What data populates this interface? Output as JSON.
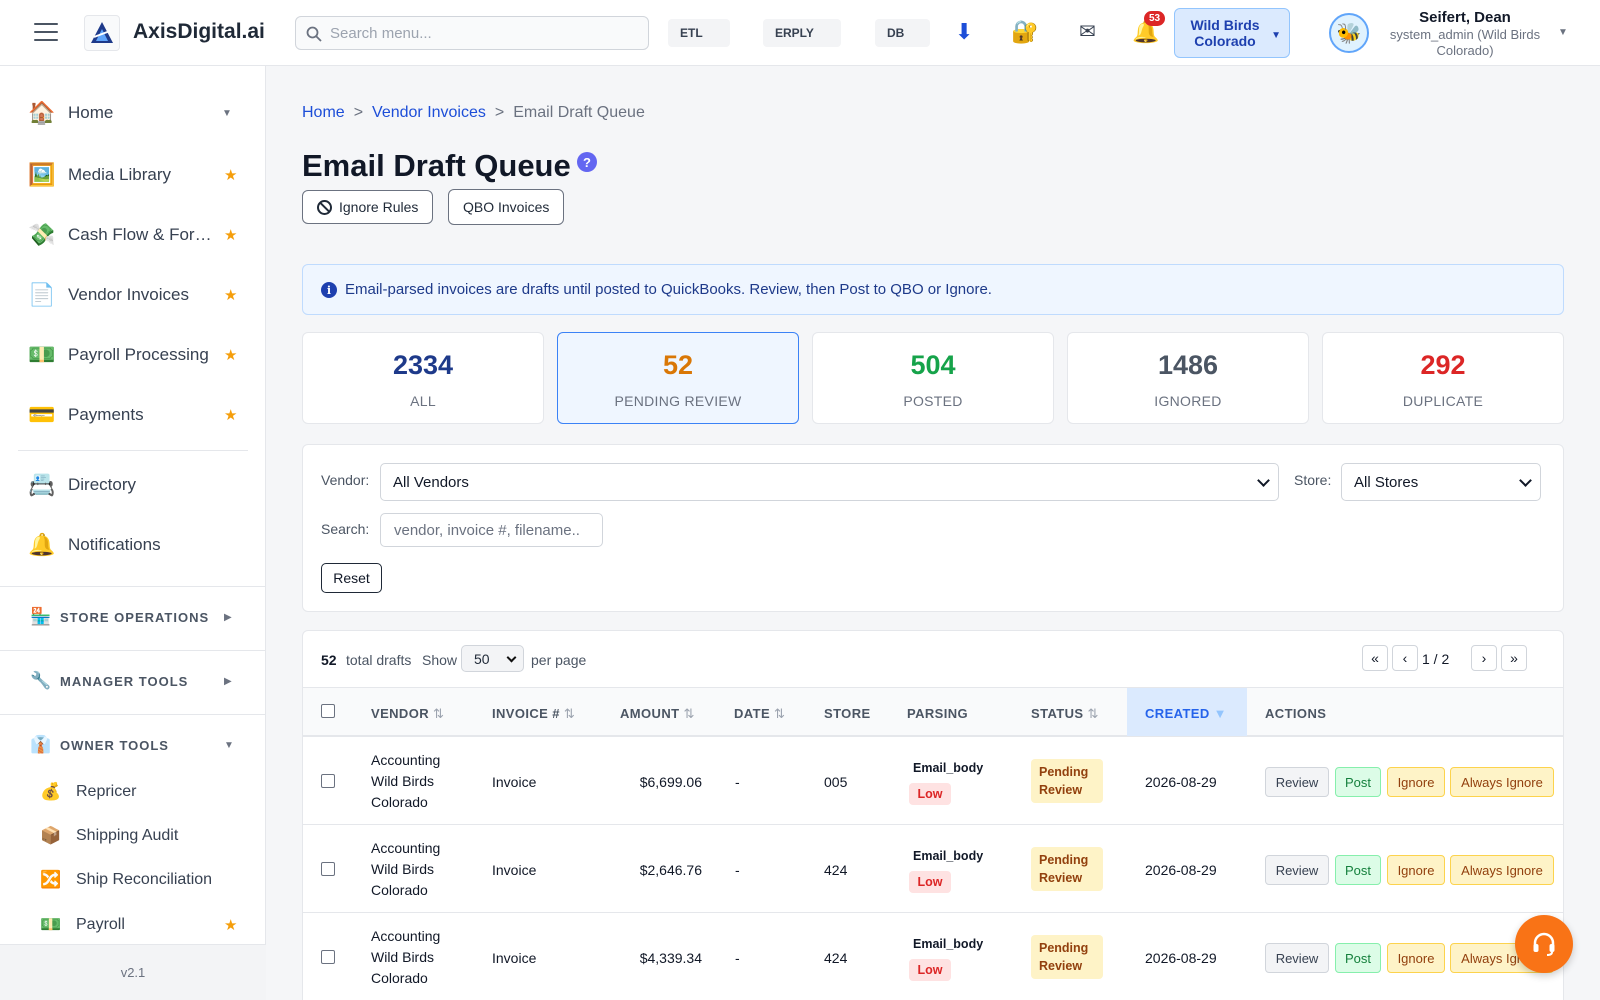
{
  "header": {
    "brand": "AxisDigital.ai",
    "search_placeholder": "Search menu...",
    "chips": [
      "ETL",
      "ERPLY",
      "DB"
    ],
    "notification_count": "53",
    "store_line1": "Wild Birds",
    "store_line2": "Colorado",
    "user_name": "Seifert, Dean",
    "user_role": "system_admin (Wild Birds Colorado)",
    "icons": [
      "download-icon",
      "lock-key-icon",
      "mail-icon",
      "bell-icon"
    ]
  },
  "sidebar": {
    "items": [
      {
        "label": "Home",
        "icon": "🏠"
      },
      {
        "label": "Media Library",
        "icon": "🖼️"
      },
      {
        "label": "Cash Flow & For…",
        "icon": "💸"
      },
      {
        "label": "Vendor Invoices",
        "icon": "📄"
      },
      {
        "label": "Payroll Processing",
        "icon": "💵"
      },
      {
        "label": "Payments",
        "icon": "💳"
      },
      {
        "label": "Directory",
        "icon": "📇"
      },
      {
        "label": "Notifications",
        "icon": "🔔"
      }
    ],
    "sections": [
      {
        "label": "STORE OPERATIONS",
        "icon": "🏪"
      },
      {
        "label": "MANAGER TOOLS",
        "icon": "🔧"
      },
      {
        "label": "OWNER TOOLS",
        "icon": "👔"
      }
    ],
    "owner_items": [
      {
        "label": "Repricer",
        "icon": "💰"
      },
      {
        "label": "Shipping Audit",
        "icon": "📦"
      },
      {
        "label": "Ship Reconciliation",
        "icon": "🔀"
      },
      {
        "label": "Payroll",
        "icon": "💵"
      }
    ],
    "version": "v2.1"
  },
  "main": {
    "breadcrumb": [
      "Home",
      "Vendor Invoices",
      "Email Draft Queue"
    ],
    "title": "Email Draft Queue",
    "help": "?",
    "btn_ignore_rules": "Ignore Rules",
    "btn_qbo": "QBO Invoices",
    "info": "Email-parsed invoices are drafts until posted to QuickBooks. Review, then Post to QBO or Ignore.",
    "stats": [
      {
        "value": "2334",
        "label": "ALL",
        "color": "#1e3a8a"
      },
      {
        "value": "52",
        "label": "PENDING REVIEW",
        "color": "#d97706"
      },
      {
        "value": "504",
        "label": "POSTED",
        "color": "#16a34a"
      },
      {
        "value": "1486",
        "label": "IGNORED",
        "color": "#4b5563"
      },
      {
        "value": "292",
        "label": "DUPLICATE",
        "color": "#dc2626"
      }
    ],
    "filters": {
      "vendor_label": "Vendor:",
      "vendor_value": "All Vendors",
      "store_label": "Store:",
      "store_value": "All Stores",
      "search_label": "Search:",
      "search_placeholder": "vendor, invoice #, filename..",
      "reset": "Reset"
    },
    "table": {
      "total": "52",
      "total_label": "total drafts",
      "show": "Show",
      "per_page_value": "50",
      "per_page_label": "per page",
      "page_info": "1 / 2",
      "pager": [
        "«",
        "‹",
        "›",
        "»"
      ],
      "columns": [
        "VENDOR",
        "INVOICE #",
        "AMOUNT",
        "DATE",
        "STORE",
        "PARSING",
        "STATUS",
        "CREATED",
        "ACTIONS"
      ],
      "sort_glyph": "⇅",
      "sort_desc": "▼",
      "actions": [
        "Review",
        "Post",
        "Ignore",
        "Always Ignore"
      ],
      "rows": [
        {
          "vendor": "Accounting Wild Birds Colorado",
          "invoice": "Invoice",
          "amount": "$6,699.06",
          "date": "-",
          "store": "005",
          "parsing": "Email_body",
          "confidence": "Low",
          "status": "Pending Review",
          "created": "2026-08-29"
        },
        {
          "vendor": "Accounting Wild Birds Colorado",
          "invoice": "Invoice",
          "amount": "$2,646.76",
          "date": "-",
          "store": "424",
          "parsing": "Email_body",
          "confidence": "Low",
          "status": "Pending Review",
          "created": "2026-08-29"
        },
        {
          "vendor": "Accounting Wild Birds Colorado",
          "invoice": "Invoice",
          "amount": "$4,339.34",
          "date": "-",
          "store": "424",
          "parsing": "Email_body",
          "confidence": "Low",
          "status": "Pending Review",
          "created": "2026-08-29"
        }
      ]
    }
  }
}
